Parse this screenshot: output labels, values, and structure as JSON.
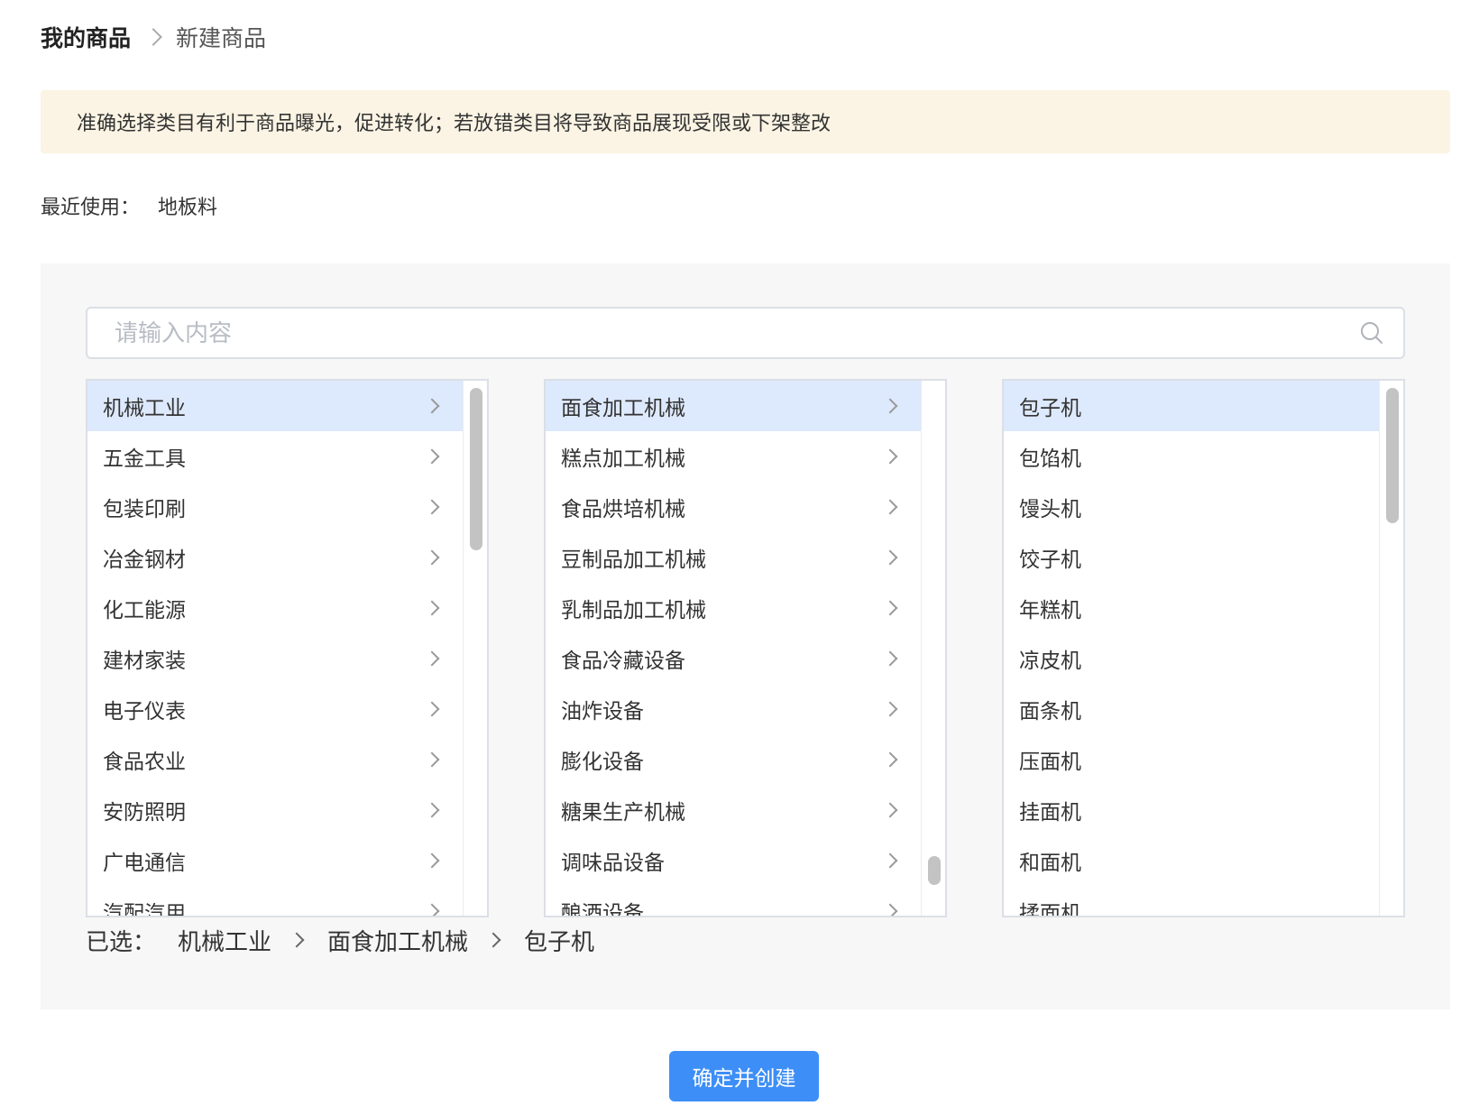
{
  "breadcrumb": {
    "root": "我的商品",
    "current": "新建商品"
  },
  "notice": {
    "text": "准确选择类目有利于商品曝光，促进转化；若放错类目将导致商品展现受限或下架整改"
  },
  "recent": {
    "label": "最近使用：",
    "items": [
      "地板料"
    ]
  },
  "search": {
    "placeholder": "请输入内容",
    "value": ""
  },
  "columns": [
    {
      "items": [
        "机械工业",
        "五金工具",
        "包装印刷",
        "冶金钢材",
        "化工能源",
        "建材家装",
        "电子仪表",
        "食品农业",
        "安防照明",
        "广电通信",
        "汽配汽用"
      ],
      "selected_index": 0,
      "has_children": true
    },
    {
      "items": [
        "面食加工机械",
        "糕点加工机械",
        "食品烘培机械",
        "豆制品加工机械",
        "乳制品加工机械",
        "食品冷藏设备",
        "油炸设备",
        "膨化设备",
        "糖果生产机械",
        "调味品设备",
        "酿酒设备"
      ],
      "selected_index": 0,
      "has_children": true
    },
    {
      "items": [
        "包子机",
        "包馅机",
        "馒头机",
        "饺子机",
        "年糕机",
        "凉皮机",
        "面条机",
        "压面机",
        "挂面机",
        "和面机",
        "揉面机"
      ],
      "selected_index": 0,
      "has_children": false
    }
  ],
  "selected_path": {
    "label": "已选：",
    "path": [
      "机械工业",
      "面食加工机械",
      "包子机"
    ]
  },
  "actions": {
    "confirm_label": "确定并创建"
  },
  "colors": {
    "accent": "#3d8ef7",
    "selected_bg": "#dde9fc",
    "notice_bg": "#fbf4e4",
    "panel_bg": "#f7f7f7"
  },
  "icons": {
    "search": "search-icon",
    "chevron": "chevron-right-icon"
  }
}
